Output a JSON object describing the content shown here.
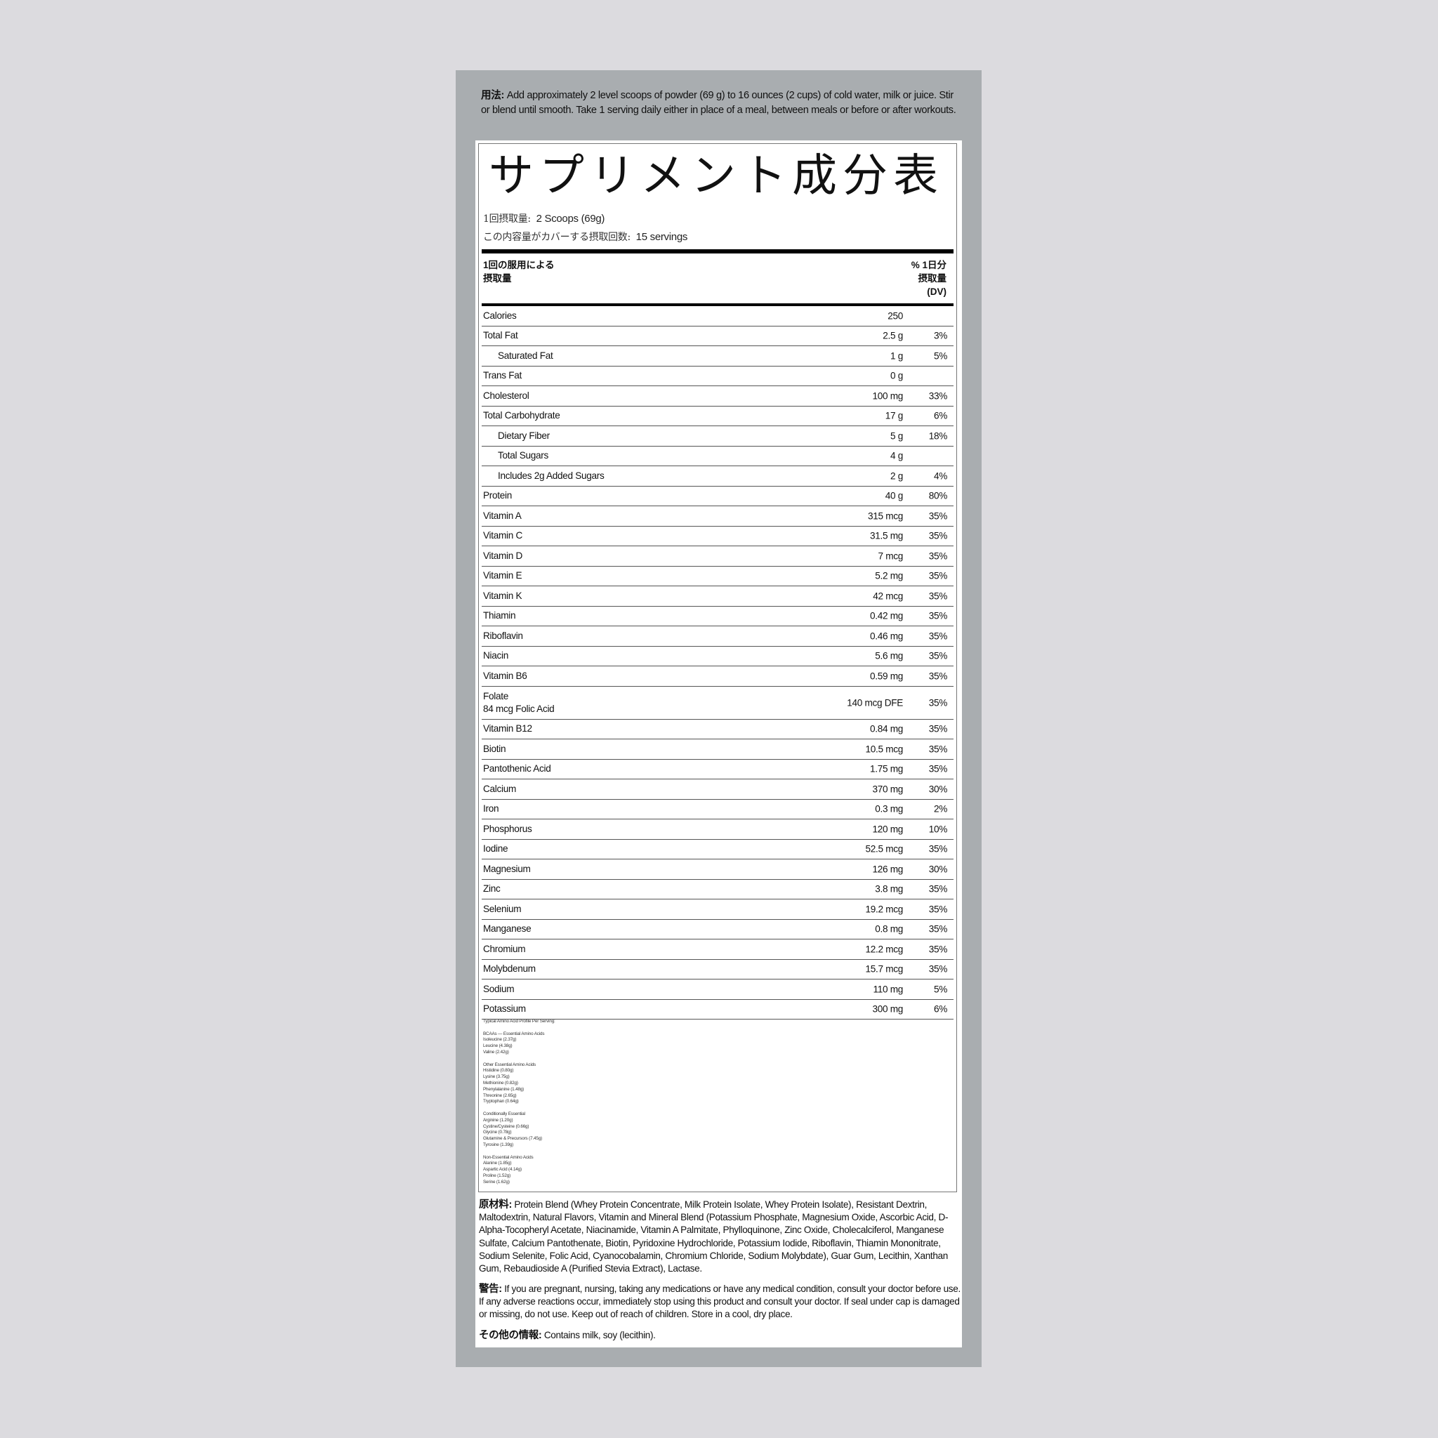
{
  "directions": {
    "label": "用法:",
    "text": "Add approximately 2 level scoops of powder (69 g) to 16 ounces (2 cups) of cold water, milk or juice. Stir or blend until smooth. Take 1 serving daily either in place of a meal, between meals or before or after workouts."
  },
  "facts": {
    "title": "サプリメント成分表",
    "serving_size_label": "1回摂取量:",
    "serving_size_value": "2 Scoops (69g)",
    "servings_per_container_label": "この内容量がカバーする摂取回数:",
    "servings_per_container_value": "15 servings",
    "header_left_line1": "1回の服用による",
    "header_left_line2": "摂取量",
    "header_right_line1": "% 1日分",
    "header_right_line2": "摂取量",
    "header_right_line3": "(DV)",
    "rows": [
      {
        "name": "Calories",
        "amount": "250",
        "dv": ""
      },
      {
        "name": "Total Fat",
        "amount": "2.5 g",
        "dv": "3%"
      },
      {
        "name": "Saturated Fat",
        "amount": "1 g",
        "dv": "5%",
        "indent": true
      },
      {
        "name": "Trans Fat",
        "amount": "0 g",
        "dv": ""
      },
      {
        "name": "Cholesterol",
        "amount": "100 mg",
        "dv": "33%"
      },
      {
        "name": "Total Carbohydrate",
        "amount": "17 g",
        "dv": "6%"
      },
      {
        "name": "Dietary Fiber",
        "amount": "5 g",
        "dv": "18%",
        "indent": true
      },
      {
        "name": "Total Sugars",
        "amount": "4 g",
        "dv": "",
        "indent": true
      },
      {
        "name": "Includes 2g Added Sugars",
        "amount": "2 g",
        "dv": "4%",
        "indent": true
      },
      {
        "name": "Protein",
        "amount": "40 g",
        "dv": "80%"
      },
      {
        "name": "Vitamin A",
        "amount": "315 mcg",
        "dv": "35%"
      },
      {
        "name": "Vitamin C",
        "amount": "31.5 mg",
        "dv": "35%"
      },
      {
        "name": "Vitamin D",
        "amount": "7 mcg",
        "dv": "35%"
      },
      {
        "name": "Vitamin E",
        "amount": "5.2 mg",
        "dv": "35%"
      },
      {
        "name": "Vitamin K",
        "amount": "42 mcg",
        "dv": "35%"
      },
      {
        "name": "Thiamin",
        "amount": "0.42 mg",
        "dv": "35%"
      },
      {
        "name": "Riboflavin",
        "amount": "0.46 mg",
        "dv": "35%"
      },
      {
        "name": "Niacin",
        "amount": "5.6 mg",
        "dv": "35%"
      },
      {
        "name": "Vitamin B6",
        "amount": "0.59 mg",
        "dv": "35%"
      },
      {
        "name": "Folate",
        "sub": "84 mcg Folic Acid",
        "amount": "140 mcg DFE",
        "dv": "35%",
        "tall": true
      },
      {
        "name": "Vitamin B12",
        "amount": "0.84 mg",
        "dv": "35%"
      },
      {
        "name": "Biotin",
        "amount": "10.5 mcg",
        "dv": "35%"
      },
      {
        "name": "Pantothenic Acid",
        "amount": "1.75 mg",
        "dv": "35%"
      },
      {
        "name": "Calcium",
        "amount": "370 mg",
        "dv": "30%"
      },
      {
        "name": "Iron",
        "amount": "0.3 mg",
        "dv": "2%"
      },
      {
        "name": "Phosphorus",
        "amount": "120 mg",
        "dv": "10%"
      },
      {
        "name": "Iodine",
        "amount": "52.5 mcg",
        "dv": "35%"
      },
      {
        "name": "Magnesium",
        "amount": "126 mg",
        "dv": "30%"
      },
      {
        "name": "Zinc",
        "amount": "3.8 mg",
        "dv": "35%"
      },
      {
        "name": "Selenium",
        "amount": "19.2 mcg",
        "dv": "35%"
      },
      {
        "name": "Manganese",
        "amount": "0.8 mg",
        "dv": "35%"
      },
      {
        "name": "Chromium",
        "amount": "12.2 mcg",
        "dv": "35%"
      },
      {
        "name": "Molybdenum",
        "amount": "15.7 mcg",
        "dv": "35%"
      },
      {
        "name": "Sodium",
        "amount": "110 mg",
        "dv": "5%"
      },
      {
        "name": "Potassium",
        "amount": "300 mg",
        "dv": "6%"
      }
    ],
    "amino_profile": {
      "title": "Typical Amino Acid Profile Per Serving:",
      "groups": [
        {
          "heading": "BCAAs — Essential Amino Acids",
          "items": [
            "Isoleucine (2.37g)",
            "Leucine (4.38g)",
            "Valine (2.42g)"
          ]
        },
        {
          "heading": "Other Essential Amino Acids",
          "items": [
            "Histidine (0.80g)",
            "Lysine (3.75g)",
            "Methionine (0.82g)",
            "Phenylalanine (1.48g)",
            "Threonine (2.65g)",
            "Tryptophan (0.64g)"
          ]
        },
        {
          "heading": "Conditionally Essential",
          "items": [
            "Arginine (1.20g)",
            "Cystine/Cysteine (0.66g)",
            "Glycine (0.78g)",
            "Glutamine & Precursors (7.45g)",
            "Tyrosine (1.39g)"
          ]
        },
        {
          "heading": "Non-Essential Amino Acids",
          "items": [
            "Alanine (1.85g)",
            "Aspartic Acid (4.14g)",
            "Proline (1.52g)",
            "Serine (1.62g)"
          ]
        }
      ]
    }
  },
  "ingredients": {
    "label": "原材料:",
    "text": "Protein Blend (Whey Protein Concentrate, Milk Protein Isolate, Whey Protein Isolate), Resistant Dextrin, Maltodextrin, Natural Flavors, Vitamin and Mineral Blend (Potassium Phosphate, Magnesium Oxide, Ascorbic Acid, D-Alpha-Tocopheryl Acetate, Niacinamide, Vitamin A Palmitate, Phylloquinone, Zinc Oxide, Cholecalciferol, Manganese Sulfate, Calcium Pantothenate, Biotin, Pyridoxine Hydrochloride, Potassium Iodide, Riboflavin, Thiamin Mononitrate, Sodium Selenite, Folic Acid, Cyanocobalamin, Chromium Chloride, Sodium Molybdate), Guar Gum, Lecithin, Xanthan Gum, Rebaudioside A (Purified Stevia Extract), Lactase."
  },
  "warning": {
    "label": "警告:",
    "text": "If you are pregnant, nursing, taking any medications or have any medical condition, consult your doctor before use. If any adverse reactions occur, immediately stop using this product and consult your doctor. If seal under cap is damaged or missing, do not use. Keep out of reach of children. Store in a cool, dry place."
  },
  "other_info": {
    "label": "その他の情報:",
    "text": "Contains milk, soy (lecithin)."
  }
}
